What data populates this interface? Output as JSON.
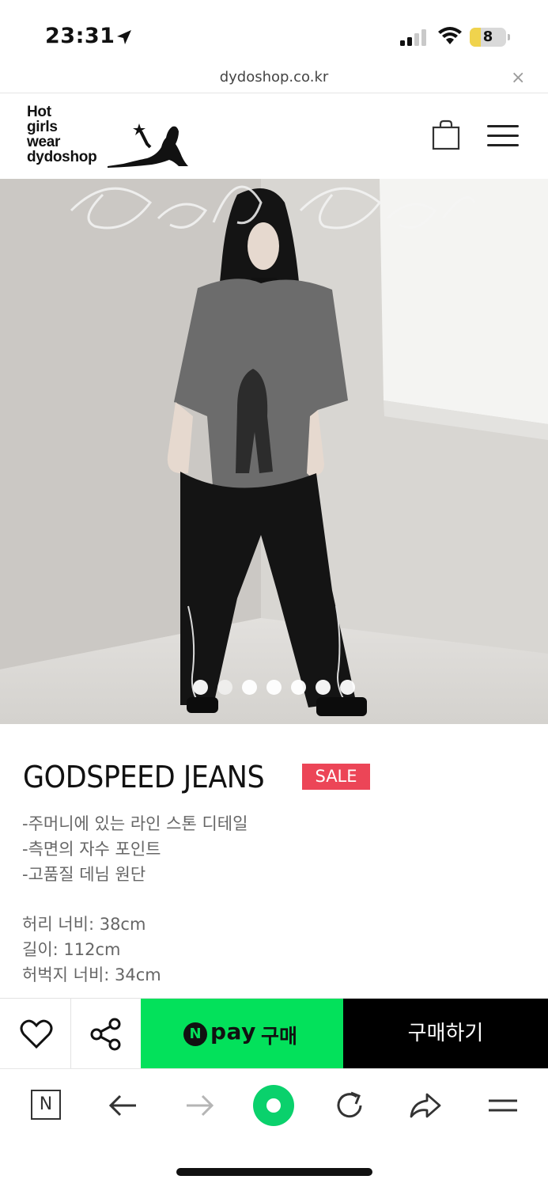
{
  "status_bar": {
    "time": "23:31",
    "battery_level": "8",
    "icons": [
      "location-arrow-icon",
      "signal-icon",
      "wifi-icon",
      "battery-icon"
    ]
  },
  "browser": {
    "url": "dydoshop.co.kr",
    "close_symbol": "×"
  },
  "site": {
    "logo_lines": [
      "Hot",
      "girls",
      "wear",
      "dydoshop"
    ],
    "icons": [
      "cart-icon",
      "menu-icon"
    ]
  },
  "hero": {
    "overlay_script": "God Speed",
    "slide_count": 7,
    "active_slide": 2
  },
  "product": {
    "title": "GODSPEED JEANS",
    "badge": "SALE",
    "badge_color": "#ec4557",
    "description": [
      "-주머니에 있는 라인 스톤 디테일",
      "-측면의 자수 포인트",
      "-고품질 데님 원단"
    ],
    "specs": [
      "허리 너비: 38cm",
      "길이: 112cm",
      "허벅지 너비: 34cm"
    ]
  },
  "actions": {
    "npay_n": "N",
    "npay_pay": "pay",
    "npay_buy": "구매",
    "npay_color": "#03e15b",
    "buy_label": "구매하기",
    "icons": [
      "heart-icon",
      "share-icon"
    ]
  },
  "toolbar": {
    "naver_label": "N",
    "icons": [
      "naver-icon",
      "back-icon",
      "forward-icon",
      "home-icon",
      "reload-icon",
      "share-icon",
      "menu-icon"
    ]
  }
}
